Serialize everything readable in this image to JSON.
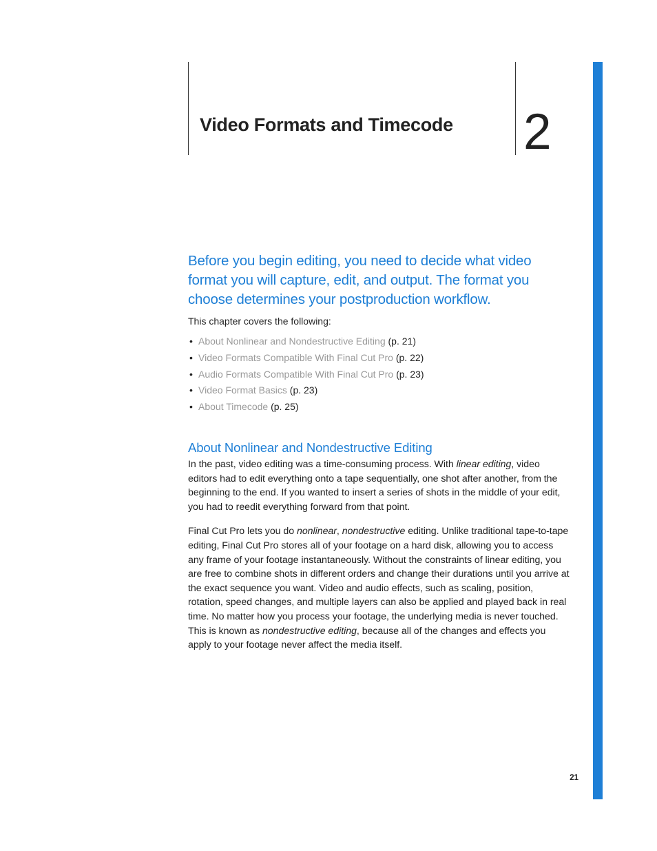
{
  "chapter": {
    "title": "Video Formats and Timecode",
    "number": "2"
  },
  "intro": "Before you begin editing, you need to decide what video format you will capture, edit, and output. The format you choose determines your postproduction workflow.",
  "covers_label": "This chapter covers the following:",
  "toc": [
    {
      "title": "About Nonlinear and Nondestructive Editing",
      "page": "(p. 21)"
    },
    {
      "title": "Video Formats Compatible With Final Cut Pro",
      "page": "(p. 22)"
    },
    {
      "title": "Audio Formats Compatible With Final Cut Pro",
      "page": "(p. 23)"
    },
    {
      "title": "Video Format Basics",
      "page": "(p. 23)"
    },
    {
      "title": "About Timecode",
      "page": "(p. 25)"
    }
  ],
  "section": {
    "heading": "About Nonlinear and Nondestructive Editing",
    "p1_a": "In the past, video editing was a time-consuming process. With ",
    "p1_i1": "linear editing",
    "p1_b": ", video editors had to edit everything onto a tape sequentially, one shot after another, from the beginning to the end. If you wanted to insert a series of shots in the middle of your edit, you had to reedit everything forward from that point.",
    "p2_a": "Final Cut Pro lets you do ",
    "p2_i1": "nonlinear",
    "p2_b": ", ",
    "p2_i2": "nondestructive",
    "p2_c": " editing. Unlike traditional tape-to-tape editing, Final Cut Pro stores all of your footage on a hard disk, allowing you to access any frame of your footage instantaneously. Without the constraints of linear editing, you are free to combine shots in different orders and change their durations until you arrive at the exact sequence you want. Video and audio effects, such as scaling, position, rotation, speed changes, and multiple layers can also be applied and played back in real time. No matter how you process your footage, the underlying media is never touched. This is known as ",
    "p2_i3": "nondestructive editing",
    "p2_d": ", because all of the changes and effects you apply to your footage never affect the media itself."
  },
  "page_number": "21"
}
